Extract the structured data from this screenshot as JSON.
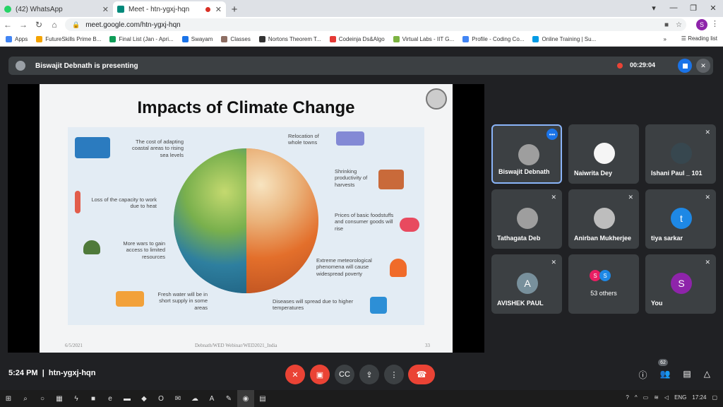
{
  "browser": {
    "tabs": [
      {
        "label": "(42) WhatsApp",
        "color": "#25d366"
      },
      {
        "label": "Meet - htn-ygxj-hqn",
        "color": "#00897b"
      }
    ],
    "new_tab": "+",
    "close": "✕",
    "url": "meet.google.com/htn-ygxj-hqn",
    "profile_initial": "S",
    "bookmarks": [
      {
        "label": "Apps",
        "color": "#4285f4"
      },
      {
        "label": "FutureSkills Prime B...",
        "color": "#f4a300"
      },
      {
        "label": "Final List (Jan - Apri...",
        "color": "#0f9d58"
      },
      {
        "label": "Swayam",
        "color": "#1a73e8"
      },
      {
        "label": "Classes",
        "color": "#8d6e63"
      },
      {
        "label": "Nortons Theorem T...",
        "color": "#333333"
      },
      {
        "label": "Codeinja Ds&Algo",
        "color": "#e53935"
      },
      {
        "label": "Virtual Labs - IIT G...",
        "color": "#7cb342"
      },
      {
        "label": "Profile - Coding Co...",
        "color": "#4285f4"
      },
      {
        "label": "Online Training | Su...",
        "color": "#039be5"
      }
    ],
    "more_bookmarks": "»",
    "reading_list": "Reading list"
  },
  "meet": {
    "presenting_text": "Biswajit Debnath is presenting",
    "recording_time": "00:29:04",
    "slide": {
      "title": "Impacts of Climate Change",
      "left_labels": [
        "The cost of adapting coastal areas to rising sea levels",
        "Loss of the capacity to work due to heat",
        "More wars to gain access to limited resources",
        "Fresh water will be in short supply in some areas"
      ],
      "right_labels": [
        "Relocation of whole towns",
        "Shrinking productivity of harvests",
        "Prices of basic foodstuffs and consumer goods will rise",
        "Extreme meteorological phenomena will cause widespread poverty",
        "Diseases will spread due to higher temperatures"
      ],
      "footer_date": "6/5/2021",
      "footer_center": "Debnath/WED Webinar/WED2021_India",
      "footer_page": "33"
    },
    "participants": [
      {
        "name": "Biswajit Debnath",
        "avatar_color": "#9e9e9e",
        "initial": ""
      },
      {
        "name": "Naiwrita Dey",
        "avatar_color": "#f5f5f5",
        "initial": ""
      },
      {
        "name": "Ishani Paul _ 101",
        "avatar_color": "#37474f",
        "initial": ""
      },
      {
        "name": "Tathagata Deb",
        "avatar_color": "#9e9e9e",
        "initial": ""
      },
      {
        "name": "Anirban Mukherjee",
        "avatar_color": "#bdbdbd",
        "initial": ""
      },
      {
        "name": "tiya sarkar",
        "avatar_color": "#1e88e5",
        "initial": "t"
      },
      {
        "name": "AVISHEK PAUL",
        "avatar_color": "#78909c",
        "initial": "A"
      },
      {
        "name": "53 others",
        "avatar_color": "#e91e63",
        "initial": "S"
      },
      {
        "name": "You",
        "avatar_color": "#8e24aa",
        "initial": "S"
      }
    ],
    "others_second_initial": "S",
    "others_second_color": "#1e88e5",
    "clock": "5:24 PM",
    "meeting_code": "htn-ygxj-hqn",
    "people_count": "62"
  },
  "taskbar": {
    "language": "ENG",
    "time": "17:24"
  }
}
